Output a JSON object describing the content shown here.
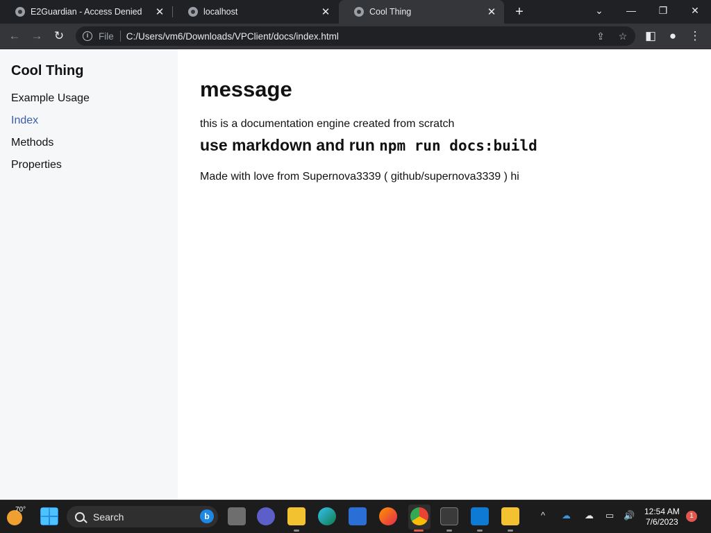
{
  "browser": {
    "tabs": [
      {
        "title": "E2Guardian - Access Denied"
      },
      {
        "title": "localhost"
      },
      {
        "title": "Cool Thing"
      }
    ],
    "new_tab": "+",
    "address": {
      "scheme": "File",
      "url": "C:/Users/vm6/Downloads/VPClient/docs/index.html"
    }
  },
  "sidebar": {
    "title": "Cool Thing",
    "links": [
      {
        "label": "Example Usage",
        "active": false
      },
      {
        "label": "Index",
        "active": true
      },
      {
        "label": "Methods",
        "active": false
      },
      {
        "label": "Properties",
        "active": false
      }
    ]
  },
  "main": {
    "heading": "message",
    "intro": "this is a documentation engine created from scratch",
    "subheading_text": "use markdown and run ",
    "subheading_code": "npm run docs:build",
    "footer_note": "Made with love from Supernova3339 ( github/supernova3339 ) hi"
  },
  "taskbar": {
    "weather": "70°",
    "search_placeholder": "Search",
    "time": "12:54 AM",
    "date": "7/6/2023",
    "notifications": "1"
  },
  "colors": {
    "active_link": "#3b5bab",
    "sidebar_bg": "#f6f7f9",
    "chrome_dark": "#202124",
    "chrome_toolbar": "#35363a"
  }
}
